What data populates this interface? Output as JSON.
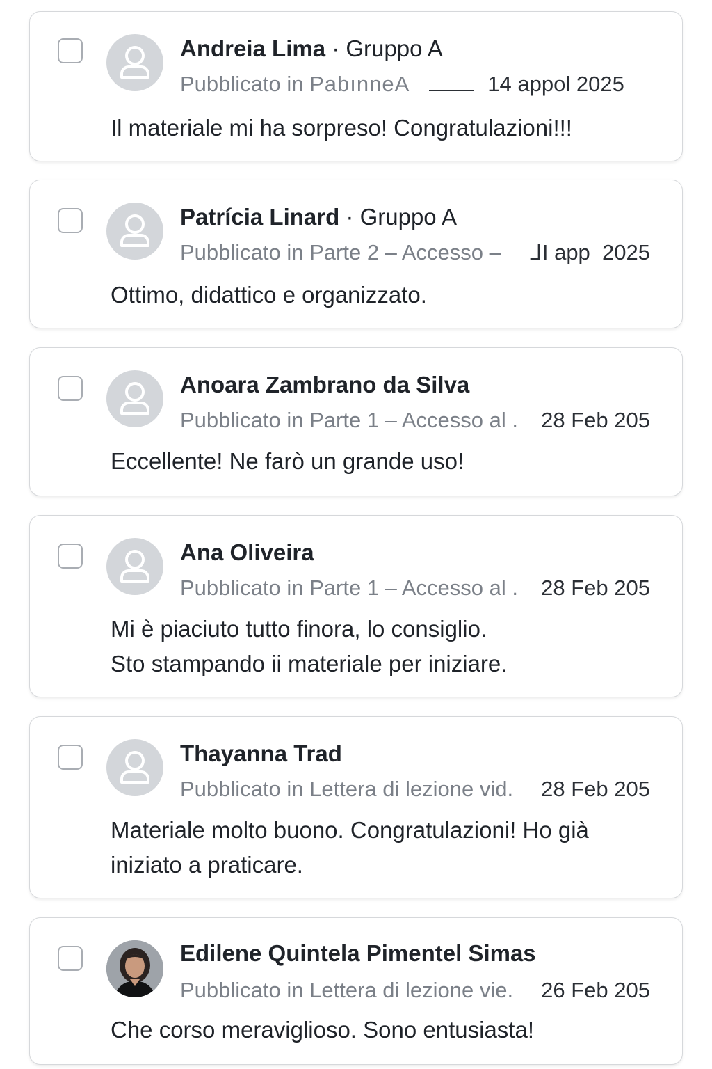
{
  "comments": [
    {
      "name": "Andreia Lima",
      "group": " · Gruppo A",
      "published_prefix": "Pubblicato in ",
      "lesson": "PabınneA",
      "date": "14 appol 2025",
      "text_lines": [
        "Il materiale mi ha sorpreso! Congratulazioni!!!"
      ],
      "avatar": "person-placeholder-icon"
    },
    {
      "name": "Patrícia Linard",
      "group": " · Gruppo A",
      "published_prefix": "Pubblicato in ",
      "lesson": "Parte 2 – Accesso –",
      "date": "⅃I app  2025",
      "text_lines": [
        "Ottimo, didattico e organizzato."
      ],
      "avatar": "person-placeholder-icon"
    },
    {
      "name": "Anoara Zambrano da Silva",
      "group": "",
      "published_prefix": "Pubblicato in ",
      "lesson": "Parte 1 – Accesso al .",
      "date": "28 Feb 205",
      "text_lines": [
        "Eccellente! Ne farò un grande uso!"
      ],
      "avatar": "person-placeholder-icon"
    },
    {
      "name": "Ana Oliveira",
      "group": "",
      "published_prefix": "Pubblicato in ",
      "lesson": "Parte 1 – Accesso al .",
      "date": "28 Feb 205",
      "text_lines": [
        "Mi è piaciuto tutto finora, lo consiglio.",
        "Sto stampando ii materiale per iniziare."
      ],
      "avatar": "person-placeholder-icon"
    },
    {
      "name": "Thayanna Trad",
      "group": "",
      "published_prefix": "Pubblicato in ",
      "lesson": "Lettera di lezione vid.",
      "date": "28 Feb 205",
      "text_lines": [
        "Materiale molto buono. Congratulazioni! Ho già",
        "iniziato a praticare."
      ],
      "avatar": "person-placeholder-icon"
    },
    {
      "name": "Edilene Quintela Pimentel Simas",
      "group": "",
      "published_prefix": "Pubblicato in ",
      "lesson": "Lettera di lezione vie.",
      "date": "26 Feb 205",
      "text_lines": [
        "Che corso meraviglioso. Sono entusiasta!"
      ],
      "avatar": "user-photo-avatar"
    }
  ],
  "colors": {
    "card_border": "#d6d8db",
    "placeholder_avatar": "#d3d6da",
    "meta_text": "#7b8088",
    "primary_text": "#1f2329"
  }
}
